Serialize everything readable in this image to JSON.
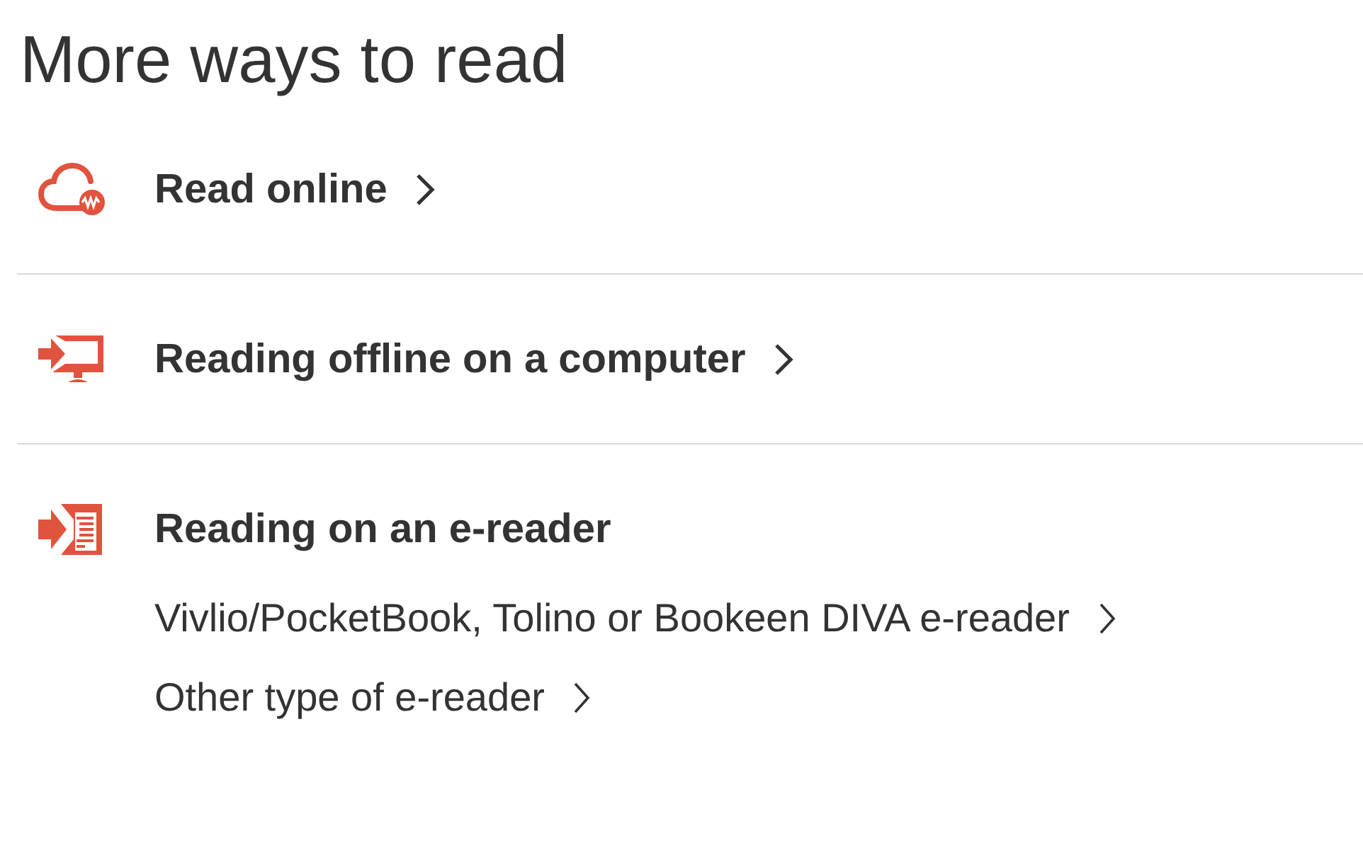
{
  "title": "More ways to read",
  "sections": [
    {
      "kind": "cloud",
      "label": "Read online"
    },
    {
      "kind": "computer",
      "label": "Reading offline on a computer"
    },
    {
      "kind": "ereader",
      "label": "Reading on an e-reader",
      "links": [
        "Vivlio/PocketBook, Tolino or Bookeen DIVA e-reader",
        "Other type of e-reader"
      ]
    }
  ]
}
